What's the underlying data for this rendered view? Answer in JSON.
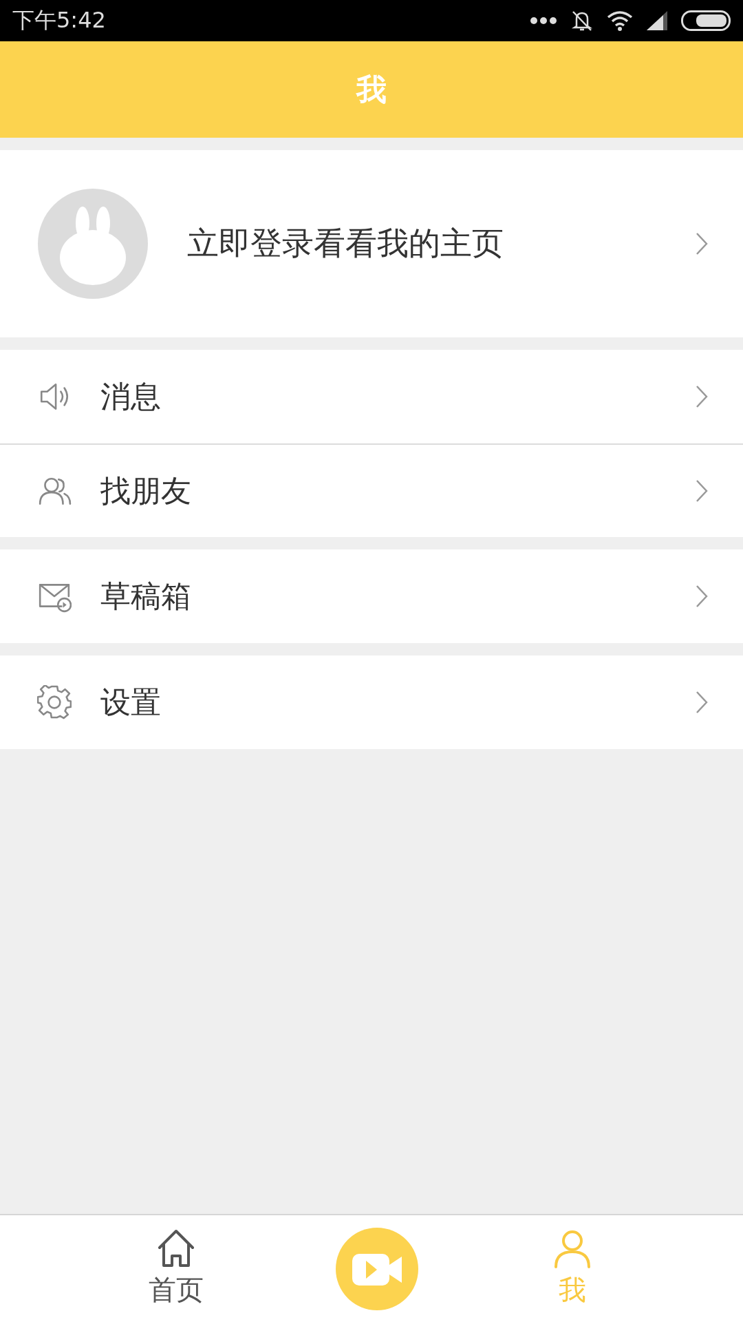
{
  "status_bar": {
    "time": "下午5:42"
  },
  "header": {
    "title": "我"
  },
  "profile": {
    "prompt": "立即登录看看我的主页"
  },
  "menu_groups": [
    {
      "items": [
        {
          "kind": "messages",
          "label": "消息"
        },
        {
          "kind": "friends",
          "label": "找朋友"
        }
      ]
    },
    {
      "items": [
        {
          "kind": "drafts",
          "label": "草稿箱"
        }
      ]
    },
    {
      "items": [
        {
          "kind": "settings",
          "label": "设置"
        }
      ]
    }
  ],
  "bottom_tabs": [
    {
      "kind": "home",
      "label": "首页",
      "selected": false
    },
    {
      "kind": "record",
      "selected": false
    },
    {
      "kind": "me",
      "label": "我",
      "selected": true
    }
  ]
}
